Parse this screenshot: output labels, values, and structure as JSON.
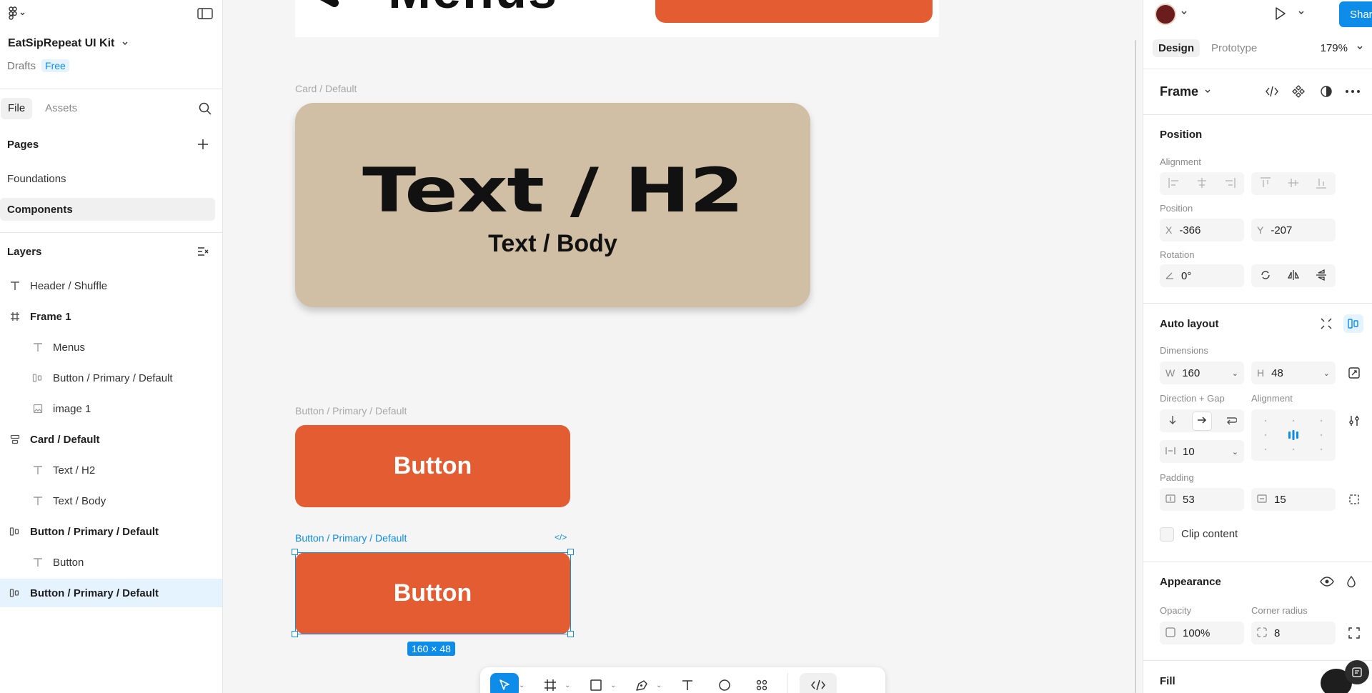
{
  "left_panel": {
    "file_title": "EatSipRepeat UI Kit",
    "drafts": "Drafts",
    "plan_badge": "Free",
    "tabs": [
      "File",
      "Assets"
    ],
    "pages_title": "Pages",
    "pages": [
      "Foundations",
      "Components"
    ],
    "layers_title": "Layers",
    "layers": [
      {
        "label": "Header / Shuffle",
        "icon": "text-icon"
      },
      {
        "label": "Frame 1",
        "icon": "frame-icon"
      },
      {
        "label": "Menus",
        "icon": "text-icon"
      },
      {
        "label": "Button / Primary / Default",
        "icon": "autolayout-icon"
      },
      {
        "label": "image 1",
        "icon": "image-icon"
      },
      {
        "label": "Card / Default",
        "icon": "autolayout-vertical-icon"
      },
      {
        "label": "Text / H2",
        "icon": "text-icon"
      },
      {
        "label": "Text / Body",
        "icon": "text-icon"
      },
      {
        "label": "Button / Primary / Default",
        "icon": "autolayout-icon"
      },
      {
        "label": "Button",
        "icon": "text-icon"
      },
      {
        "label": "Button / Primary / Default",
        "icon": "autolayout-icon"
      }
    ]
  },
  "canvas": {
    "top_text": "Menus",
    "card_label": "Card / Default",
    "card_h2": "Text / H2",
    "card_body": "Text / Body",
    "button1_label": "Button / Primary / Default",
    "button1_text": "Button",
    "button2_label": "Button / Primary / Default",
    "button2_text": "Button",
    "selection_size": "160 × 48",
    "colors": {
      "button": "#e45c32",
      "card": "#d0bfa4",
      "selection": "#0d8ce9",
      "canvas": "#f5f5f5"
    }
  },
  "right_panel": {
    "share_label": "Share",
    "tabs": [
      "Design",
      "Prototype"
    ],
    "zoom": "179%",
    "frame_label": "Frame",
    "position_title": "Position",
    "alignment_label": "Alignment",
    "position_label": "Position",
    "x_prefix": "X",
    "x_value": "-366",
    "y_prefix": "Y",
    "y_value": "-207",
    "rotation_label": "Rotation",
    "rotation_value": "0°",
    "auto_layout_title": "Auto layout",
    "dimensions_label": "Dimensions",
    "w_prefix": "W",
    "w_value": "160",
    "h_prefix": "H",
    "h_value": "48",
    "direction_gap_label": "Direction + Gap",
    "alignment2_label": "Alignment",
    "gap_value": "10",
    "padding_label": "Padding",
    "padding_h": "53",
    "padding_v": "15",
    "clip_label": "Clip content",
    "appearance_title": "Appearance",
    "opacity_label": "Opacity",
    "opacity_value": "100%",
    "corner_label": "Corner radius",
    "corner_value": "8",
    "fill_title": "Fill"
  }
}
